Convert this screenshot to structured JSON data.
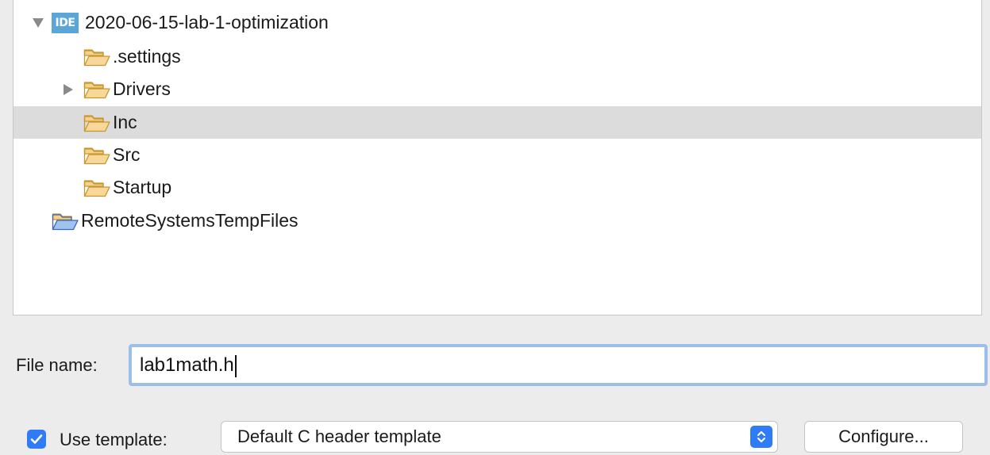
{
  "tree": {
    "project": {
      "label": "2020-06-15-lab-1-optimization",
      "badge": "IDE"
    },
    "children": [
      {
        "label": ".settings"
      },
      {
        "label": "Drivers"
      },
      {
        "label": "Inc"
      },
      {
        "label": "Src"
      },
      {
        "label": "Startup"
      }
    ],
    "other": {
      "label": "RemoteSystemsTempFiles"
    }
  },
  "form": {
    "file_name_label": "File name:",
    "file_name_value": "lab1math.h",
    "use_template_label": "Use template:",
    "use_template_checked": true,
    "template_value": "Default C header template",
    "configure_label": "Configure..."
  },
  "colors": {
    "accent": "#2f7cf6",
    "folder": "#f1c477",
    "selection": "#dcdcdc"
  }
}
